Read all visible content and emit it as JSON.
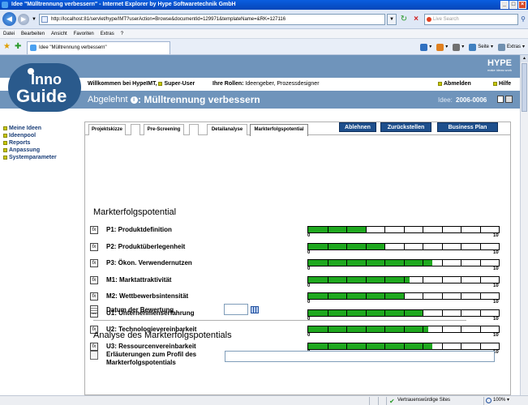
{
  "browser": {
    "window_title": "Idee \"Mülltrennung verbessern\" - Internet Explorer by Hype Softwaretechnik GmbH",
    "url": "http://localhost:81/servlet/hype/IMT?userAction=Browse&documentId=129971&templateName=&RK=127116",
    "search_placeholder": "Live Search",
    "menu": [
      "Datei",
      "Bearbeiten",
      "Ansicht",
      "Favoriten",
      "Extras",
      "?"
    ],
    "tab_title": "Idee \"Mülltrennung verbessern\"",
    "commands": [
      {
        "label": "",
        "icon": "home-icon",
        "color": "#3070c0"
      },
      {
        "label": "",
        "icon": "feeds-icon",
        "color": "#e08020"
      },
      {
        "label": "",
        "icon": "print-icon",
        "color": "#707070"
      },
      {
        "label": "Seite",
        "icon": "page-icon",
        "color": "#4080c0"
      },
      {
        "label": "Extras",
        "icon": "tools-icon",
        "color": "#7090b0"
      }
    ],
    "status_trusted": "Vertrauenswürdige Sites",
    "zoom": "100%"
  },
  "app": {
    "logo_line1": "Inno",
    "logo_line2": "Guide",
    "hype_brand": "HYPE",
    "hype_tagline": "make ideas work",
    "welcome_prefix": "Willkommen bei HypeIMT,",
    "user_name": "Super-User",
    "roles_label": "Ihre Rollen:",
    "roles_value": "Ideengeber, Prozessdesigner",
    "logout": "Abmelden",
    "help": "Hilfe",
    "status": "Abgelehnt",
    "idea_title": ": Mülltrennung verbessern",
    "idea_id_label": "Idee:",
    "idea_id": "2006-0006"
  },
  "sidebar": {
    "items": [
      "Meine Ideen",
      "Ideenpool",
      "Reports",
      "Anpassung",
      "Systemparameter"
    ]
  },
  "tabs": [
    "Projektskizze",
    "Pre-Screening",
    "Detailanalyse",
    "Markterfolgspotential"
  ],
  "actions": {
    "reject": "Ablehnen",
    "reset": "Zurückstellen",
    "business_plan": "Business Plan"
  },
  "section": {
    "title": "Markterfolgspotential",
    "scale_min": "0",
    "scale_max": "10",
    "criteria": [
      {
        "label": "P1: Produktdefinition",
        "value": 3
      },
      {
        "label": "P2: Produktüberlegenheit",
        "value": 4
      },
      {
        "label": "P3: Ökon. Verwendernutzen",
        "value": 6.5
      },
      {
        "label": "M1: Marktattraktivität",
        "value": 5.3
      },
      {
        "label": "M2: Wettbewerbsintensität",
        "value": 5
      },
      {
        "label": "U1: Unternehmenserfahrung",
        "value": 6
      },
      {
        "label": "U2: Technologievereinbarkeit",
        "value": 6.3
      },
      {
        "label": "U3: Ressourcenvereinbarkeit",
        "value": 6.5
      }
    ],
    "date_label": "Datum der Bewertung",
    "date_value": ""
  },
  "analysis": {
    "title": "Analyse des Markterfolgspotentials",
    "comment_label": "Erläuterungen zum Profil des Markterfolgspotentials",
    "comment_value": ""
  }
}
